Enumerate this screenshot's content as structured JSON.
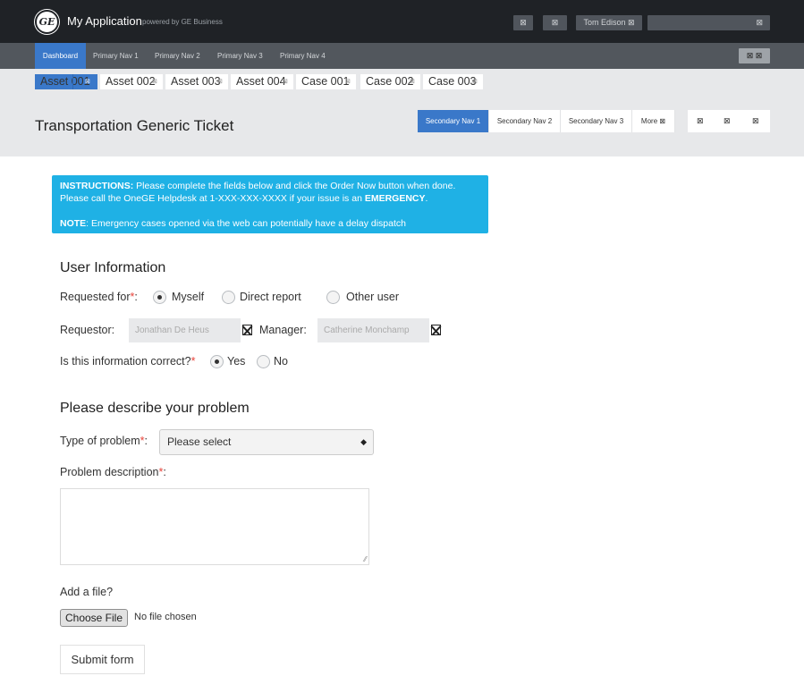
{
  "header": {
    "logo_text": "GE",
    "app_title": "My Application",
    "powered_by": "powered by GE Business",
    "icon_a": "⊠",
    "icon_b": "⊠",
    "user_label": "Tom Edison ⊠",
    "search_icon": "⊠"
  },
  "primary_nav": {
    "items": [
      {
        "label": "Dashboard"
      },
      {
        "label": "Primary Nav 1"
      },
      {
        "label": "Primary Nav 2"
      },
      {
        "label": "Primary Nav 3"
      },
      {
        "label": "Primary Nav 4"
      }
    ],
    "right_button": "⊠ ⊠"
  },
  "tabs": [
    {
      "label": "Asset 001",
      "close": "⊠"
    },
    {
      "label": "Asset 002",
      "close": "⊠"
    },
    {
      "label": "Asset 003",
      "close": "⊠"
    },
    {
      "label": "Asset 004",
      "close": "⊠"
    },
    {
      "label": "Case 001",
      "close": "⊠"
    },
    {
      "label": "Case 002",
      "close": "⊠"
    },
    {
      "label": "Case 003",
      "close": "⊠"
    }
  ],
  "page": {
    "title": "Transportation Generic Ticket",
    "secondary_nav": [
      {
        "label": "Secondary Nav 1"
      },
      {
        "label": "Secondary Nav 2"
      },
      {
        "label": "Secondary Nav 3"
      },
      {
        "label": "More ⊠"
      }
    ],
    "icons": [
      "⊠",
      "⊠",
      "⊠"
    ]
  },
  "instructions": {
    "line1_bold": "INSTRUCTIONS:",
    "line1": " Please complete the fields below and click the Order Now button when done.",
    "line2": "Please call the OneGE Helpdesk at 1-XXX-XXX-XXXX if your issue is an ",
    "line2_bold": "EMERGENCY",
    "line2_end": ".",
    "note_bold": "NOTE",
    "note": ": Emergency cases opened via the web can potentially have a delay dispatch"
  },
  "user_info": {
    "heading": "User Information",
    "requested_for_label": "Requested for",
    "requested_for_suffix": ":",
    "options": [
      "Myself",
      "Direct report",
      "Other user"
    ],
    "selected": "Myself",
    "requestor_label": "Requestor:",
    "requestor_value": "Jonathan De Heus",
    "manager_label": "Manager:",
    "manager_value": "Catherine Monchamp",
    "correct_label": "Is this information correct?",
    "correct_options": [
      "Yes",
      "No"
    ],
    "correct_selected": "Yes"
  },
  "problem": {
    "heading": "Please describe your problem",
    "type_label": "Type of problem",
    "type_suffix": ":",
    "type_value": "Please select",
    "type_caret": "◆",
    "desc_label": "Problem description",
    "desc_suffix": ":",
    "required_mark": "*",
    "add_file_label": "Add a file?",
    "choose_file": "Choose File",
    "no_file": "No file chosen",
    "submit": "Submit form"
  }
}
